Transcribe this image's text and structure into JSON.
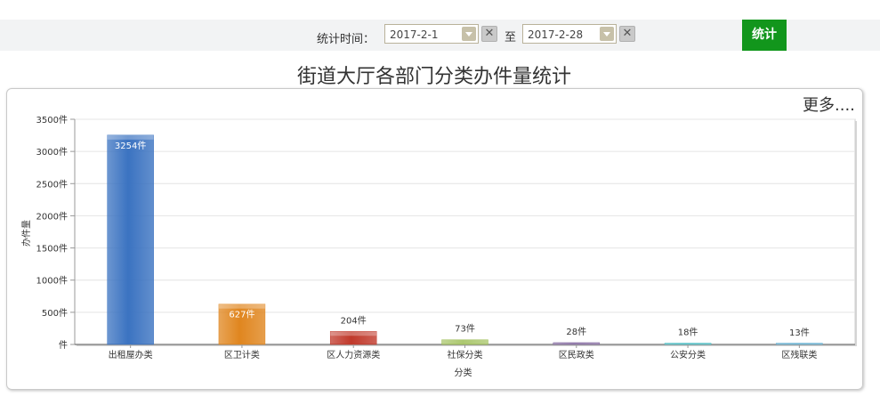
{
  "filter": {
    "label": "统计时间：",
    "start_date": "2017-2-1",
    "to_label": "至",
    "end_date": "2017-2-28",
    "clear_symbol": "✕",
    "submit_label": "统计"
  },
  "more_link": "更多....",
  "chart_data": {
    "type": "bar",
    "title": "街道大厅各部门分类办件量统计",
    "xlabel": "分类",
    "ylabel": "办件量",
    "ylim": [
      0,
      3500
    ],
    "yticks": [
      "件",
      "500件",
      "1000件",
      "1500件",
      "2000件",
      "2500件",
      "3000件",
      "3500件"
    ],
    "categories": [
      "出租屋办类",
      "区卫计类",
      "区人力资源类",
      "社保分类",
      "区民政类",
      "公安分类",
      "区残联类"
    ],
    "values": [
      3254,
      627,
      204,
      73,
      28,
      18,
      13
    ],
    "value_labels": [
      "3254件",
      "627件",
      "204件",
      "73件",
      "28件",
      "18件",
      "13件"
    ],
    "colors": [
      "#3b73c1",
      "#e0861f",
      "#c0392b",
      "#8db33a",
      "#6a4a8c",
      "#2ab0b8",
      "#4aa2c9"
    ],
    "grid": true,
    "legend": "none"
  }
}
